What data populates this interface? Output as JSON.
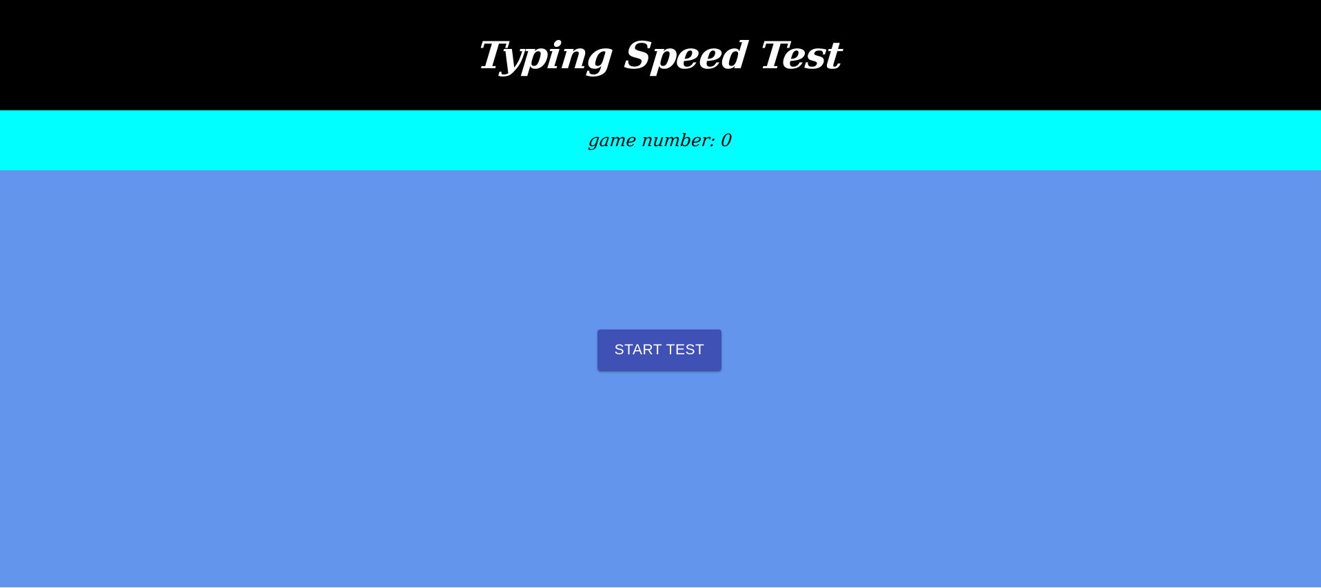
{
  "header": {
    "title": "Typing Speed Test"
  },
  "game_bar": {
    "label": "game number: 0"
  },
  "main": {
    "start_button_label": "START TEST"
  },
  "colors": {
    "header_bg": "#000000",
    "game_bar_bg": "#00ffff",
    "main_bg": "#6495ed",
    "button_bg": "#3f51b5",
    "button_text": "#ffffff"
  }
}
